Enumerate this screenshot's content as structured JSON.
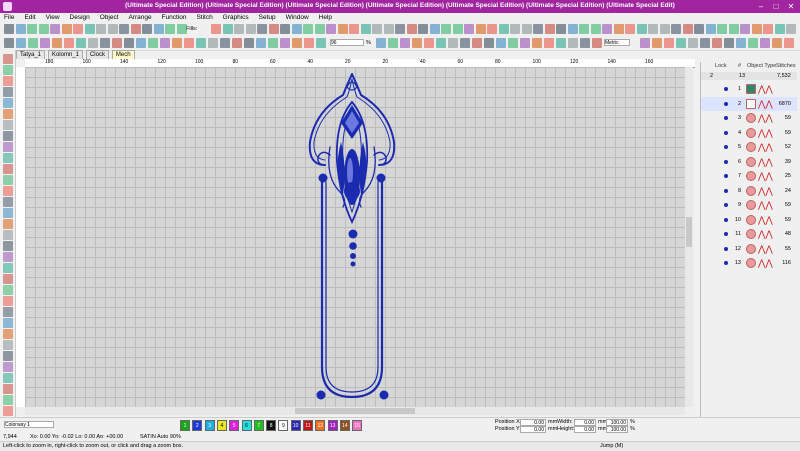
{
  "window": {
    "title": "(Ultimate Special Edition) (Ultimate Special Edition) (Ultimate Special Edition) (Ultimate Special Edition) (Ultimate Special Edition) (Ultimate Special Edition) (Ultimate Special Edit)",
    "minimize": "–",
    "maximize": "□",
    "close": "✕"
  },
  "menu": [
    "File",
    "Edit",
    "View",
    "Design",
    "Object",
    "Arrange",
    "Function",
    "Stitch",
    "Graphics",
    "Setup",
    "Window",
    "Help"
  ],
  "toolbar": {
    "fills_label": "Fills:",
    "zoom_value": "96",
    "zoom_unit": "%",
    "units_value": "Metric"
  },
  "tabs": [
    "Tatya_1",
    "Kolomn_1",
    "Clock",
    "Mech"
  ],
  "ruler_labels": [
    "180",
    "160",
    "140",
    "120",
    "100",
    "80",
    "60",
    "40",
    "20",
    "20",
    "40",
    "60",
    "80",
    "100",
    "120",
    "140",
    "160"
  ],
  "panel": {
    "headers": [
      "Lock",
      "#",
      "Object Type",
      "Stitches"
    ],
    "summary": {
      "count": "13",
      "stitches": "7,532",
      "index": "2"
    },
    "objects": [
      {
        "n": "1",
        "stitches": ""
      },
      {
        "n": "2",
        "stitches": "6870"
      },
      {
        "n": "3",
        "stitches": "59"
      },
      {
        "n": "4",
        "stitches": "59"
      },
      {
        "n": "5",
        "stitches": "52"
      },
      {
        "n": "6",
        "stitches": "39"
      },
      {
        "n": "7",
        "stitches": "25"
      },
      {
        "n": "8",
        "stitches": "24"
      },
      {
        "n": "9",
        "stitches": "59"
      },
      {
        "n": "10",
        "stitches": "59"
      },
      {
        "n": "11",
        "stitches": "48"
      },
      {
        "n": "12",
        "stitches": "55"
      },
      {
        "n": "13",
        "stitches": "116"
      }
    ]
  },
  "bottom": {
    "colorway": "Colorway 1",
    "swatches": [
      {
        "n": "1",
        "color": "#1aa51a"
      },
      {
        "n": "2",
        "color": "#1a3ae0"
      },
      {
        "n": "3",
        "color": "#1ab0e0"
      },
      {
        "n": "4",
        "color": "#e8e820"
      },
      {
        "n": "5",
        "color": "#e020e0"
      },
      {
        "n": "6",
        "color": "#20e0e0"
      },
      {
        "n": "7",
        "color": "#20c020"
      },
      {
        "n": "8",
        "color": "#101010"
      },
      {
        "n": "9",
        "color": "#ffffff"
      },
      {
        "n": "10",
        "color": "#2a2ab0"
      },
      {
        "n": "11",
        "color": "#c01818"
      },
      {
        "n": "12",
        "color": "#f07020"
      },
      {
        "n": "13",
        "color": "#a020c0"
      },
      {
        "n": "14",
        "color": "#905020"
      },
      {
        "n": "15",
        "color": "#f070c0"
      }
    ],
    "position_x_label": "Position X:",
    "position_y_label": "Position Y:",
    "width_label": "Width:",
    "height_label": "Height:",
    "pos_x": "0.00",
    "pos_y": "0.00",
    "width": "0.00",
    "height": "0.00",
    "scale_w": "100.00",
    "scale_h": "100.00",
    "unit_mm": "mm",
    "unit_pct": "%"
  },
  "status": {
    "stitch_count": "7,944",
    "coords": "Xo: 0.00 Yo: -0.02 Lo: 0.00 Ao: +00.00",
    "stitch_type": "SATIN Auto 90%",
    "hint": "Left-click to zoom in, right-click to zoom out, or click and drag a zoom box.",
    "mode": "Jump (M)"
  },
  "colors": {
    "titlebar": "#a0259f",
    "stitch_blue": "#1a2bb0",
    "stitch_light": "#6b78e0"
  }
}
